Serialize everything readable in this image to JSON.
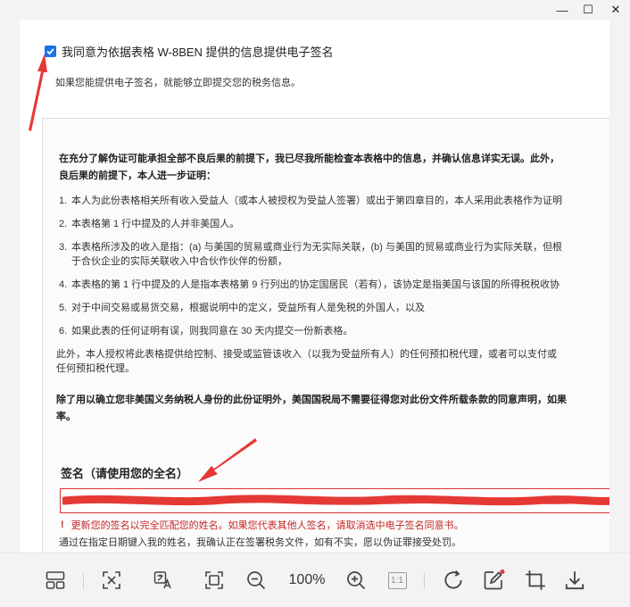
{
  "window": {
    "minimize_glyph": "—",
    "maximize_glyph": "☐",
    "close_glyph": "✕"
  },
  "consent": {
    "checked": true,
    "label": "我同意为依据表格 W-8BEN 提供的信息提供电子签名",
    "hint": "如果您能提供电子签名，就能够立即提交您的税务信息。"
  },
  "certification": {
    "intro_line1": "在充分了解伪证可能承担全部不良后果的前提下，我已尽我所能检查本表格中的信息，并确认信息详实无误。此外，",
    "intro_line2": "良后果的前提下，本人进一步证明：",
    "items": [
      {
        "num": "1.",
        "text": "本人为此份表格相关所有收入受益人（或本人被授权为受益人签署）或出于第四章目的，本人采用此表格作为证明"
      },
      {
        "num": "2.",
        "text": "本表格第 1 行中提及的人并非美国人。"
      },
      {
        "num": "3.",
        "text": "本表格所涉及的收入是指：(a) 与美国的贸易或商业行为无实际关联，(b) 与美国的贸易或商业行为实际关联，但根",
        "text2": "于合伙企业的实际关联收入中合伙作伙伴的份额，"
      },
      {
        "num": "4.",
        "text": "本表格的第 1 行中提及的人是指本表格第 9 行列出的协定国居民（若有），该协定是指美国与该国的所得税税收协"
      },
      {
        "num": "5.",
        "text": "对于中间交易或易货交易，根据说明中的定义，受益所有人是免税的外国人，以及"
      },
      {
        "num": "6.",
        "text": "如果此表的任何证明有误，则我同意在 30 天内提交一份新表格。"
      }
    ],
    "authorization_line1": "此外，本人授权将此表格提供给控制、接受或监管该收入（以我为受益所有人）的任何预扣税代理，或者可以支付或",
    "authorization_line2": "任何预扣税代理。",
    "irs_line1": "除了用以确立您非美国义务纳税人身份的此份证明外，美国国税局不需要征得您对此份文件所载条款的同意声明，如果",
    "irs_line2": "率。"
  },
  "signature": {
    "label": "签名（请使用您的全名）",
    "error_mark": "!",
    "error_text": "更新您的签名以完全匹配您的姓名。如果您代表其他人签名，请取消选中电子签名同意书。",
    "note": "通过在指定日期键入我的姓名，我确认正在签署税务文件，如有不实，愿以伪证罪接受处罚。"
  },
  "toolbar": {
    "zoom_level": "100%",
    "actual_size_label": "1:1",
    "icons": [
      "layout-icon",
      "fit-icon",
      "translate-icon",
      "crop-frame-icon",
      "zoom-out-icon",
      "zoom-in-icon",
      "actual-size-icon",
      "rotate-icon",
      "edit-icon",
      "crop-icon",
      "download-icon"
    ]
  },
  "colors": {
    "accent": "#1a73e8",
    "error": "#c62828",
    "annotation_red": "#e53935",
    "toolbar_bg": "#f3f3f3"
  }
}
